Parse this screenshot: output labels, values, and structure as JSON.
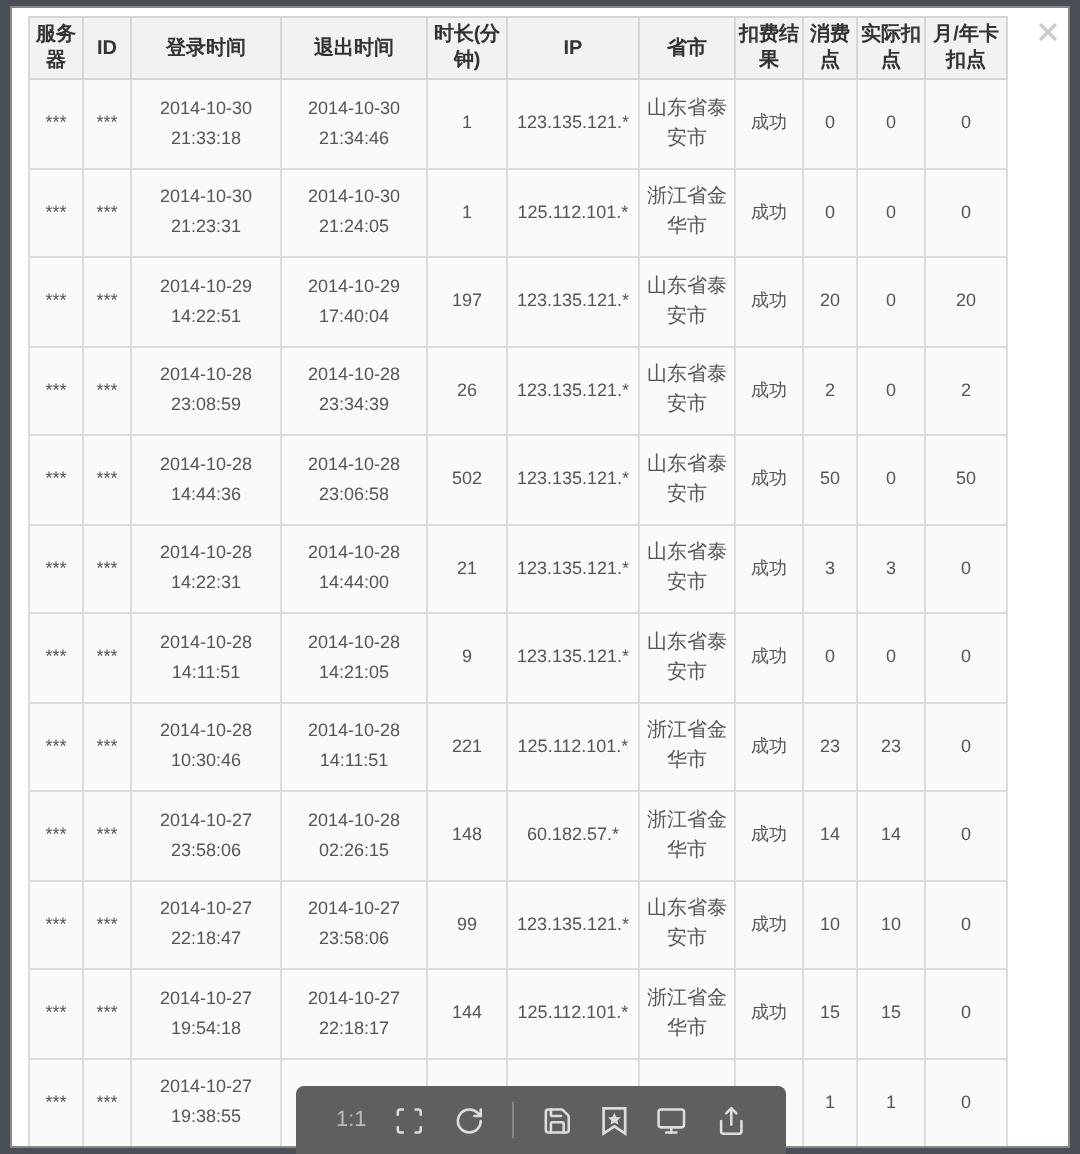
{
  "table": {
    "columns": [
      "服务器",
      "ID",
      "登录时间",
      "退出时间",
      "时长(分钟)",
      "IP",
      "省市",
      "扣费结果",
      "消费点",
      "实际扣点",
      "月/年卡扣点"
    ],
    "rows": [
      [
        "***",
        "***",
        "2014-10-30 21:33:18",
        "2014-10-30 21:34:46",
        "1",
        "123.135.121.*",
        "山东省泰安市",
        "成功",
        "0",
        "0",
        "0"
      ],
      [
        "***",
        "***",
        "2014-10-30 21:23:31",
        "2014-10-30 21:24:05",
        "1",
        "125.112.101.*",
        "浙江省金华市",
        "成功",
        "0",
        "0",
        "0"
      ],
      [
        "***",
        "***",
        "2014-10-29 14:22:51",
        "2014-10-29 17:40:04",
        "197",
        "123.135.121.*",
        "山东省泰安市",
        "成功",
        "20",
        "0",
        "20"
      ],
      [
        "***",
        "***",
        "2014-10-28 23:08:59",
        "2014-10-28 23:34:39",
        "26",
        "123.135.121.*",
        "山东省泰安市",
        "成功",
        "2",
        "0",
        "2"
      ],
      [
        "***",
        "***",
        "2014-10-28 14:44:36",
        "2014-10-28 23:06:58",
        "502",
        "123.135.121.*",
        "山东省泰安市",
        "成功",
        "50",
        "0",
        "50"
      ],
      [
        "***",
        "***",
        "2014-10-28 14:22:31",
        "2014-10-28 14:44:00",
        "21",
        "123.135.121.*",
        "山东省泰安市",
        "成功",
        "3",
        "3",
        "0"
      ],
      [
        "***",
        "***",
        "2014-10-28 14:11:51",
        "2014-10-28 14:21:05",
        "9",
        "123.135.121.*",
        "山东省泰安市",
        "成功",
        "0",
        "0",
        "0"
      ],
      [
        "***",
        "***",
        "2014-10-28 10:30:46",
        "2014-10-28 14:11:51",
        "221",
        "125.112.101.*",
        "浙江省金华市",
        "成功",
        "23",
        "23",
        "0"
      ],
      [
        "***",
        "***",
        "2014-10-27 23:58:06",
        "2014-10-28 02:26:15",
        "148",
        "60.182.57.*",
        "浙江省金华市",
        "成功",
        "14",
        "14",
        "0"
      ],
      [
        "***",
        "***",
        "2014-10-27 22:18:47",
        "2014-10-27 23:58:06",
        "99",
        "123.135.121.*",
        "山东省泰安市",
        "成功",
        "10",
        "10",
        "0"
      ],
      [
        "***",
        "***",
        "2014-10-27 19:54:18",
        "2014-10-27 22:18:17",
        "144",
        "125.112.101.*",
        "浙江省金华市",
        "成功",
        "15",
        "15",
        "0"
      ],
      [
        "***",
        "***",
        "2014-10-27 19:38:55",
        null,
        null,
        null,
        null,
        null,
        "1",
        "1",
        "0"
      ]
    ]
  },
  "viewer_toolbar": {
    "zoom_label": "1:1"
  }
}
